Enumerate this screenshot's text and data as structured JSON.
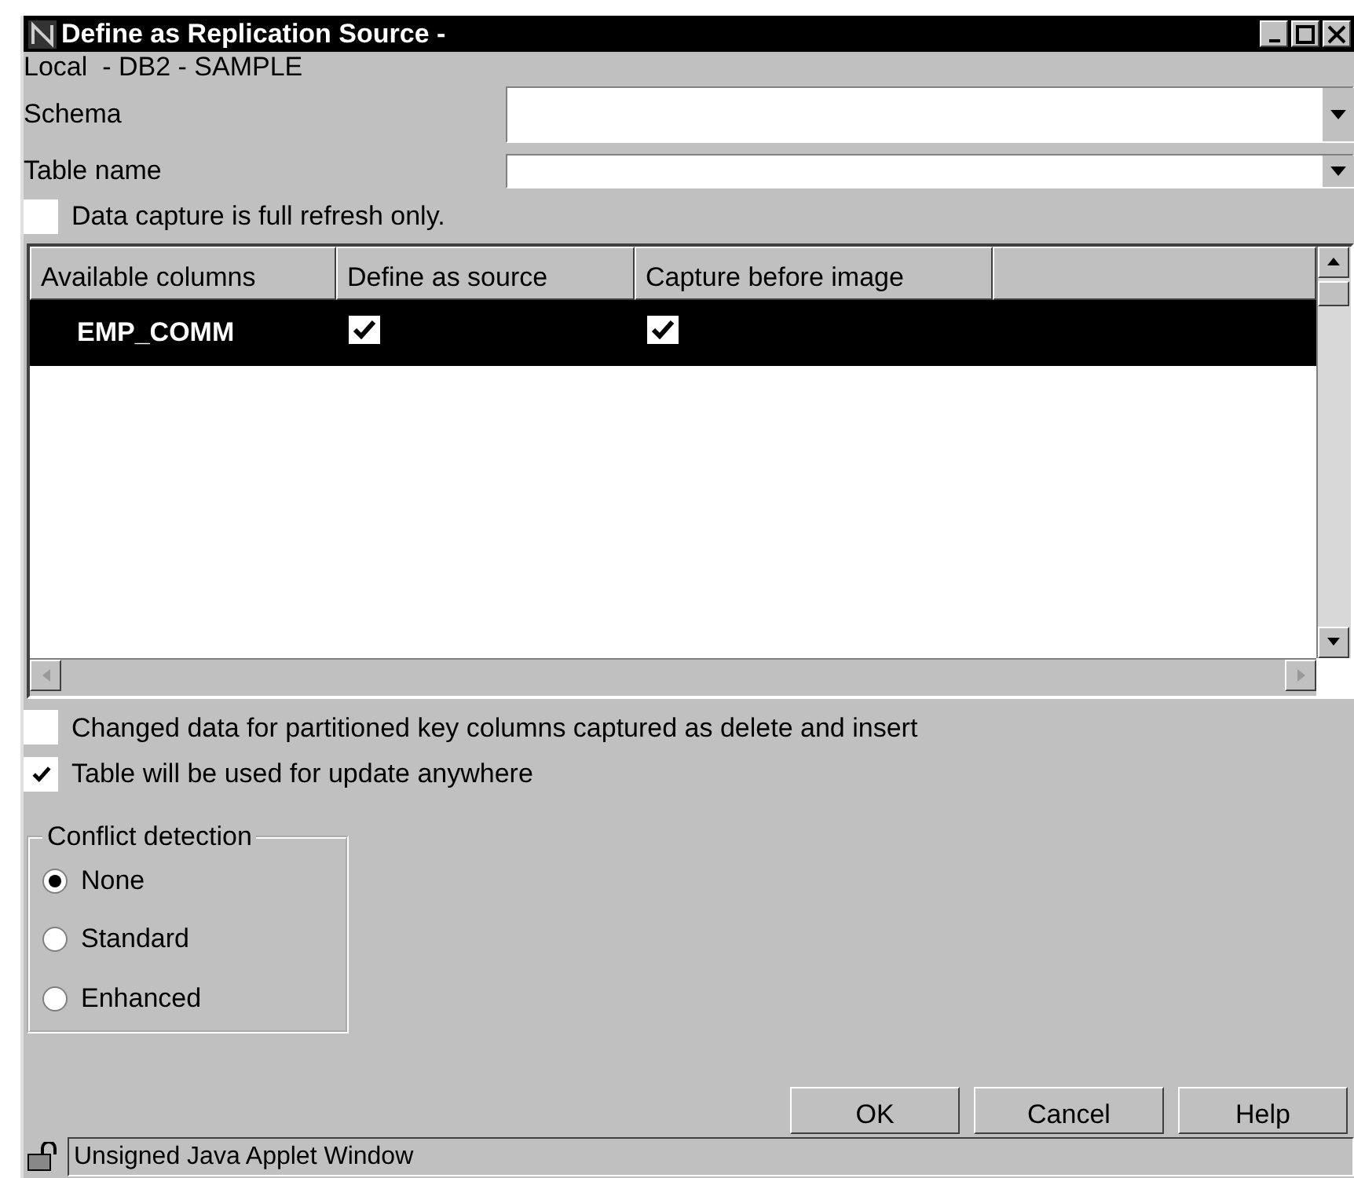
{
  "window": {
    "title": "Define as Replication Source -"
  },
  "location": "Local  - DB2 - SAMPLE",
  "fields": [
    {
      "label": "Schema"
    },
    {
      "label": "Table name"
    }
  ],
  "full_refresh": {
    "label": "Data capture is full refresh only.",
    "checked": false
  },
  "table": {
    "columns": [
      "Available columns",
      "Define as source",
      "Capture before image"
    ],
    "rows": [
      {
        "name": "EMP_COMM",
        "define_as_source": true,
        "capture_before_image": true,
        "selected": true
      }
    ]
  },
  "options": [
    {
      "label": "Changed data for partitioned key columns captured as delete and insert",
      "checked": false
    },
    {
      "label": "Table will be used for update anywhere",
      "checked": true
    }
  ],
  "conflict_detection": {
    "title": "Conflict detection",
    "choices": [
      {
        "label": "None",
        "selected": true
      },
      {
        "label": "Standard",
        "selected": false
      },
      {
        "label": "Enhanced",
        "selected": false
      }
    ]
  },
  "buttons": [
    "OK",
    "Cancel",
    "Help"
  ],
  "status_bar": "Unsigned Java Applet Window"
}
